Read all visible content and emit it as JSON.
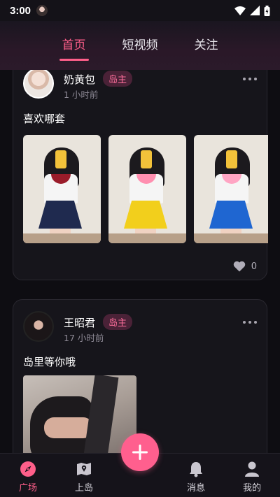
{
  "status_bar": {
    "time": "3:00",
    "icons": [
      "avatar-icon",
      "wifi-icon",
      "signal-icon",
      "battery-icon"
    ]
  },
  "header": {
    "tabs": [
      {
        "label": "首页",
        "active": true
      },
      {
        "label": "短视频",
        "active": false
      },
      {
        "label": "关注",
        "active": false
      }
    ]
  },
  "posts": [
    {
      "username": "奶黄包",
      "badge": "岛主",
      "time": "1 小时前",
      "text": "喜欢哪套",
      "likes": "0",
      "skirt_colors": [
        "#1f2a4f",
        "#f2cf1c",
        "#1f66d1"
      ],
      "collar_colors": [
        "#9a1c2a",
        "#ff8fb0",
        "#ffa5c4"
      ]
    },
    {
      "username": "王昭君",
      "badge": "岛主",
      "time": "17 小时前",
      "text": "岛里等你哦"
    }
  ],
  "bottom_nav": {
    "items": [
      {
        "label": "广场",
        "icon": "compass-icon",
        "active": true
      },
      {
        "label": "上岛",
        "icon": "map-icon",
        "active": false
      },
      {
        "label": "消息",
        "icon": "bell-icon",
        "active": false
      },
      {
        "label": "我的",
        "icon": "person-icon",
        "active": false
      }
    ],
    "fab_icon": "plus-icon"
  },
  "colors": {
    "accent": "#ff5f8a",
    "background": "#0e0d12",
    "card": "#16151b"
  }
}
